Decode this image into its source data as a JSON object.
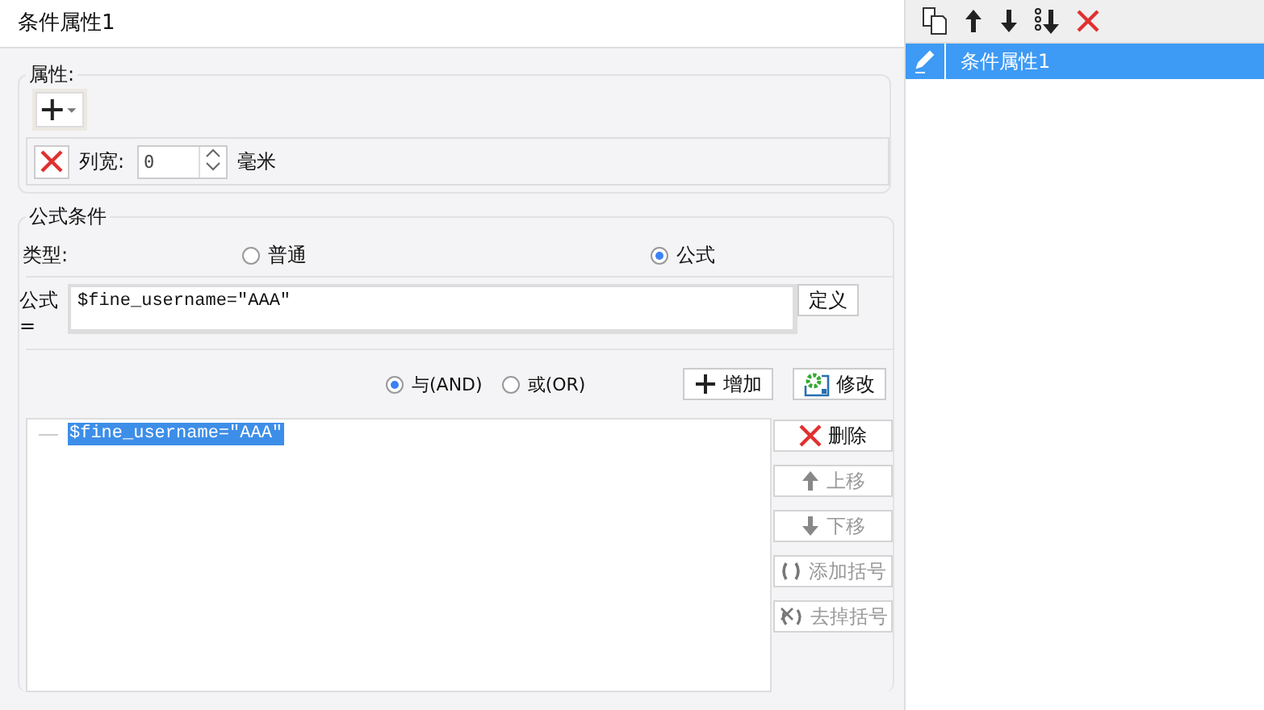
{
  "title": "条件属性1",
  "attributes": {
    "label": "属性:",
    "rows": [
      {
        "label": "列宽:",
        "value": "0",
        "unit": "毫米"
      }
    ]
  },
  "formula_condition": {
    "label": "公式条件",
    "type_label": "类型:",
    "types": [
      {
        "label": "普通",
        "selected": false
      },
      {
        "label": "公式",
        "selected": true
      }
    ],
    "formula_label": "公式=",
    "formula_value": "$fine_username=\"AAA\"",
    "define_button": "定义",
    "logic": [
      {
        "label": "与(AND)",
        "selected": true
      },
      {
        "label": "或(OR)",
        "selected": false
      }
    ],
    "add_button": "增加",
    "modify_button": "修改",
    "conditions": [
      {
        "text": "$fine_username=\"AAA\"",
        "selected": true
      }
    ],
    "actions": [
      {
        "kind": "delete",
        "label": "删除",
        "disabled": false
      },
      {
        "kind": "up",
        "label": "上移",
        "disabled": true
      },
      {
        "kind": "down",
        "label": "下移",
        "disabled": true
      },
      {
        "kind": "add_paren",
        "label": "添加括号",
        "disabled": true
      },
      {
        "kind": "remove_paren",
        "label": "去掉括号",
        "disabled": true
      }
    ]
  },
  "right_panel": {
    "items": [
      {
        "label": "条件属性1",
        "selected": true
      }
    ]
  }
}
